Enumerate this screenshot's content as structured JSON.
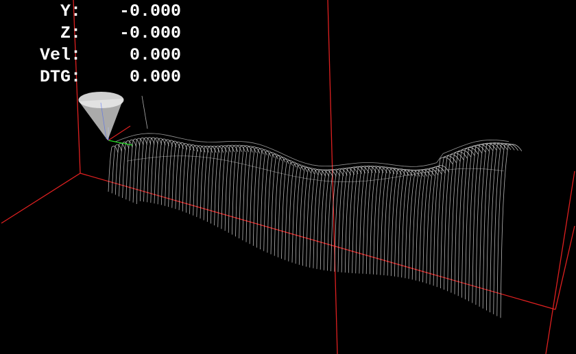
{
  "dro": {
    "rows": [
      {
        "label": "Y:",
        "value": "-0.000"
      },
      {
        "label": "Z:",
        "value": "-0.000"
      },
      {
        "label": "Vel:",
        "value": "0.000"
      },
      {
        "label": "DTG:",
        "value": "0.000"
      }
    ]
  },
  "colors": {
    "background": "#000000",
    "text": "#ffffff",
    "extents": "#e02020",
    "toolpath": "#d8d8d8",
    "tool": "#c8c8c8",
    "axis_x": "#e02020",
    "axis_y": "#20e020",
    "axis_z": "#4060ff"
  }
}
